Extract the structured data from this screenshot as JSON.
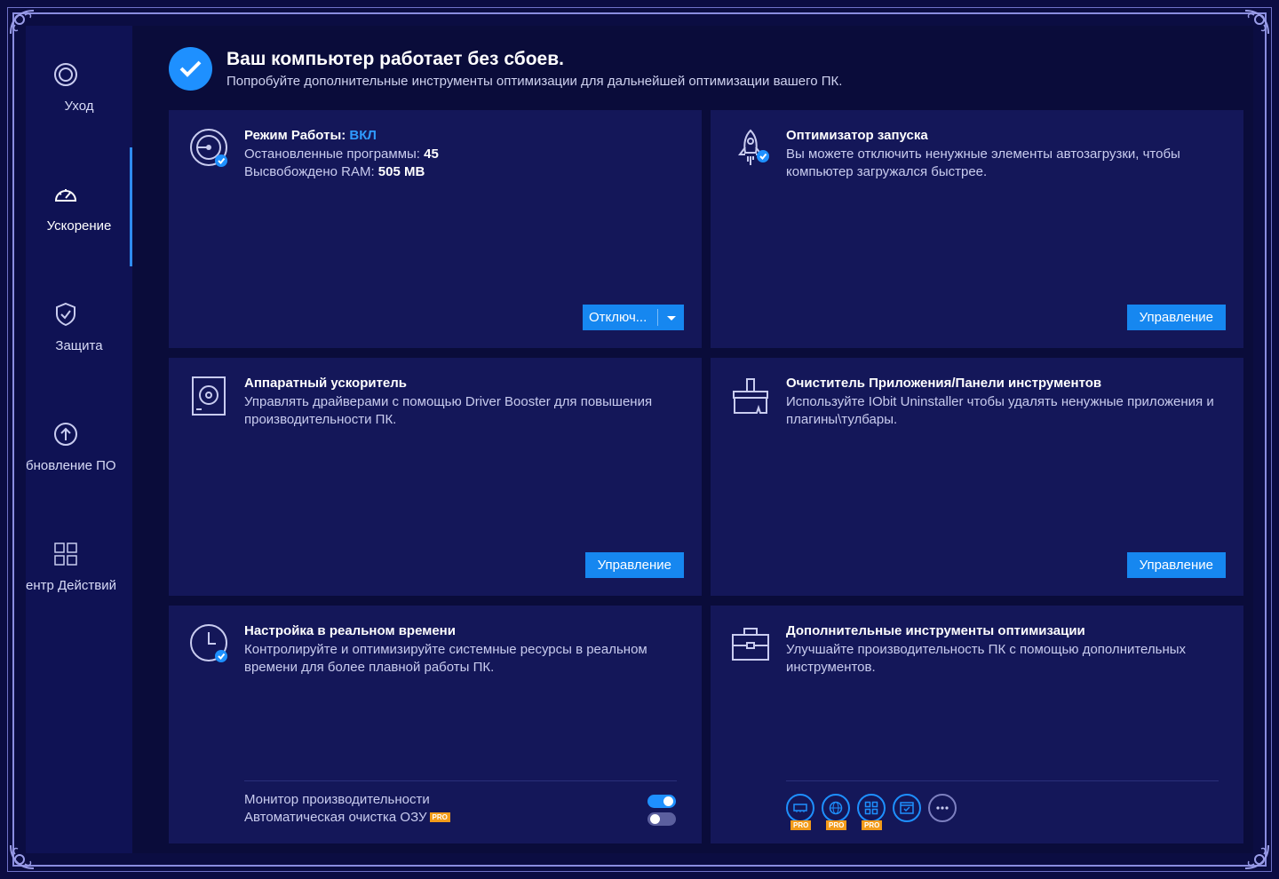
{
  "sidebar": {
    "items": [
      {
        "label": "Уход",
        "icon": "ring-icon"
      },
      {
        "label": "Ускорение",
        "icon": "speedometer-icon"
      },
      {
        "label": "Защита",
        "icon": "shield-icon"
      },
      {
        "label": "бновление ПО",
        "icon": "update-arrow-icon"
      },
      {
        "label": "ентр Действий",
        "icon": "grid-icon"
      }
    ],
    "active_index": 1
  },
  "header": {
    "title": "Ваш компьютер работает без сбоев.",
    "subtitle": "Попробуйте дополнительные инструменты оптимизации для дальнейшей оптимизации вашего ПК."
  },
  "cards": {
    "work_mode": {
      "title_prefix": "Режим Работы: ",
      "title_state": "ВКЛ",
      "stopped_label": "Остановленные программы: ",
      "stopped_value": "45",
      "freed_label": "Высвобождено RAM: ",
      "freed_value": "505 MB",
      "button": "Отключ..."
    },
    "startup": {
      "title": "Оптимизатор запуска",
      "text": "Вы можете отключить ненужные элементы автозагрузки, чтобы компьютер загружался быстрее.",
      "button": "Управление"
    },
    "hardware": {
      "title": "Аппаратный ускоритель",
      "text": "Управлять драйверами с помощью Driver Booster для повышения производительности ПК.",
      "button": "Управление"
    },
    "cleaner": {
      "title": "Очиститель Приложения/Панели инструментов",
      "text": "Используйте IObit Uninstaller чтобы удалять ненужные приложения и плагины\\тулбары.",
      "button": "Управление"
    },
    "realtime": {
      "title": "Настройка в реальном времени",
      "text": "Контролируйте и оптимизируйте системные ресурсы в реальном времени для более плавной работы ПК.",
      "toggles": [
        {
          "label": "Монитор производительности",
          "on": true,
          "pro": false
        },
        {
          "label": "Автоматическая очистка ОЗУ",
          "on": false,
          "pro": true
        }
      ],
      "pro_badge": "PRO"
    },
    "extra": {
      "title": "Дополнительные инструменты оптимизации",
      "text": "Улучшайте производительность ПК с помощью дополнительных инструментов.",
      "tools": [
        {
          "icon": "ram-icon",
          "pro": true
        },
        {
          "icon": "globe-rocket-icon",
          "pro": true
        },
        {
          "icon": "apps-icon",
          "pro": true
        },
        {
          "icon": "browser-check-icon",
          "pro": false
        },
        {
          "icon": "more-icon",
          "pro": false
        }
      ],
      "pro_badge": "PRO"
    }
  },
  "colors": {
    "accent": "#1e90ff",
    "card_bg": "#141759",
    "sidebar_bg": "#0f1254",
    "pro_badge": "#f29b1a"
  }
}
